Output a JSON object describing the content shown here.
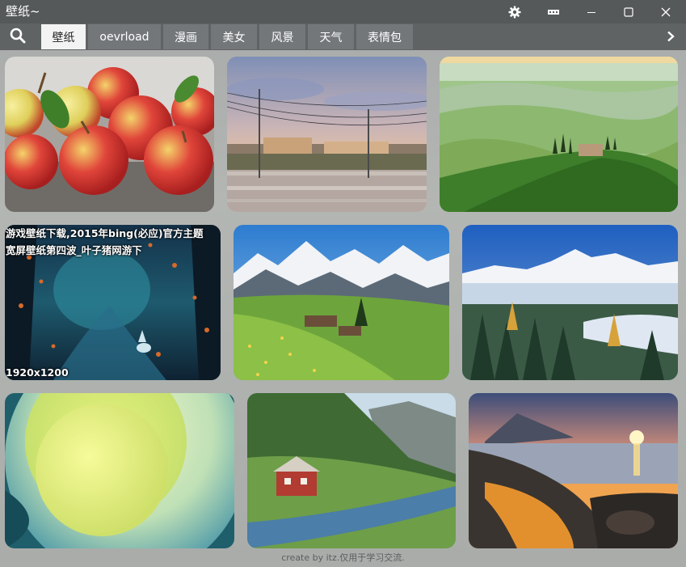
{
  "window": {
    "title": "壁纸~"
  },
  "titlebar_icons": [
    "gear-icon",
    "skin-icon",
    "minimize-icon",
    "maximize-icon",
    "close-icon"
  ],
  "tabs": [
    {
      "label": "壁纸",
      "active": true
    },
    {
      "label": "oevrload",
      "active": false
    },
    {
      "label": "漫画",
      "active": false
    },
    {
      "label": "美女",
      "active": false
    },
    {
      "label": "风景",
      "active": false
    },
    {
      "label": "天气",
      "active": false
    },
    {
      "label": "表情包",
      "active": false
    }
  ],
  "gallery": {
    "hovered_item": {
      "caption": "游戏壁纸下载,2015年bing(必应)官方主题\n宽屏壁纸第四波_叶子猪网游下",
      "resolution": "1920x1200"
    }
  },
  "footer": {
    "text": "create by itz.仅用于学习交流."
  },
  "colors": {
    "titlebar": "#55595a",
    "tabsbar": "#5f6364",
    "tab_active": "#f3f3f3",
    "tab_inactive": "#73777a"
  }
}
